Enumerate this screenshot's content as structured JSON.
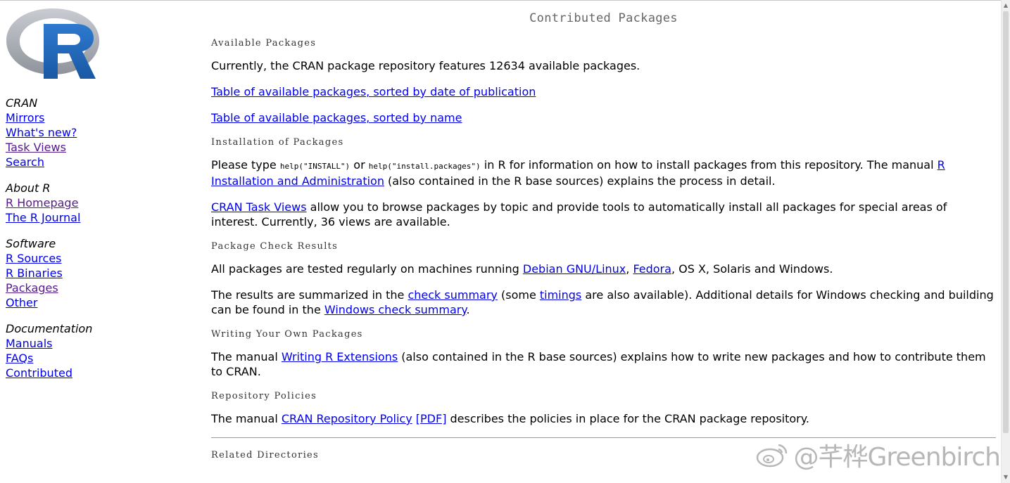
{
  "page_title": "Contributed Packages",
  "logo_letter": "R",
  "sidebar": {
    "groups": [
      {
        "title": "CRAN",
        "links": [
          {
            "label": "Mirrors",
            "visited": false
          },
          {
            "label": "What's new?",
            "visited": false
          },
          {
            "label": "Task Views",
            "visited": true
          },
          {
            "label": "Search",
            "visited": false
          }
        ]
      },
      {
        "title": "About R",
        "links": [
          {
            "label": "R Homepage",
            "visited": true
          },
          {
            "label": "The R Journal",
            "visited": false
          }
        ]
      },
      {
        "title": "Software",
        "links": [
          {
            "label": "R Sources",
            "visited": false
          },
          {
            "label": "R Binaries",
            "visited": false
          },
          {
            "label": "Packages",
            "visited": true
          },
          {
            "label": "Other",
            "visited": false
          }
        ]
      },
      {
        "title": "Documentation",
        "links": [
          {
            "label": "Manuals",
            "visited": false
          },
          {
            "label": "FAQs",
            "visited": false
          },
          {
            "label": "Contributed",
            "visited": false
          }
        ]
      }
    ]
  },
  "sections": {
    "available": {
      "heading": "Available Packages",
      "intro": "Currently, the CRAN package repository features 12634 available packages.",
      "link_by_date": "Table of available packages, sorted by date of publication",
      "link_by_name": "Table of available packages, sorted by name"
    },
    "installation": {
      "heading": "Installation of Packages",
      "p1_a": "Please type ",
      "code1": "help(\"INSTALL\")",
      "p1_b": " or ",
      "code2": "help(\"install.packages\")",
      "p1_c": " in R for information on how to install packages from this repository. The manual ",
      "link_manual": "R Installation and Administration",
      "p1_d": " (also contained in the R base sources) explains the process in detail.",
      "link_taskviews": "CRAN Task Views",
      "p2": " allow you to browse packages by topic and provide tools to automatically install all packages for special areas of interest. Currently, 36 views are available."
    },
    "checks": {
      "heading": "Package Check Results",
      "p1_a": "All packages are tested regularly on machines running ",
      "link_debian": "Debian GNU/Linux",
      "p1_b": ", ",
      "link_fedora": "Fedora",
      "p1_c": ", OS X, Solaris and Windows.",
      "p2_a": "The results are summarized in the ",
      "link_summary": "check summary",
      "p2_b": " (some ",
      "link_timings": "timings",
      "p2_c": " are also available). Additional details for Windows checking and building can be found in the ",
      "link_windows": "Windows check summary",
      "p2_d": "."
    },
    "writing": {
      "heading": "Writing Your Own Packages",
      "p_a": "The manual ",
      "link": "Writing R Extensions",
      "p_b": " (also contained in the R base sources) explains how to write new packages and how to contribute them to CRAN."
    },
    "policies": {
      "heading": "Repository Policies",
      "p_a": "The manual ",
      "link": "CRAN Repository Policy",
      "p_b": " ",
      "link_pdf": "[PDF]",
      "p_c": " describes the policies in place for the CRAN package repository."
    },
    "related": {
      "heading": "Related Directories"
    }
  },
  "watermark": "@芊桦Greenbirch",
  "icons": {
    "logo": "r-logo-icon",
    "watermark": "weibo-icon",
    "scroll_up": "scroll-up-icon",
    "scroll_down": "scroll-down-icon"
  },
  "colors": {
    "link": "#0000ee",
    "visited": "#551a8b",
    "logo_blue": "#2167b8",
    "logo_ring": "#a8abb2"
  }
}
